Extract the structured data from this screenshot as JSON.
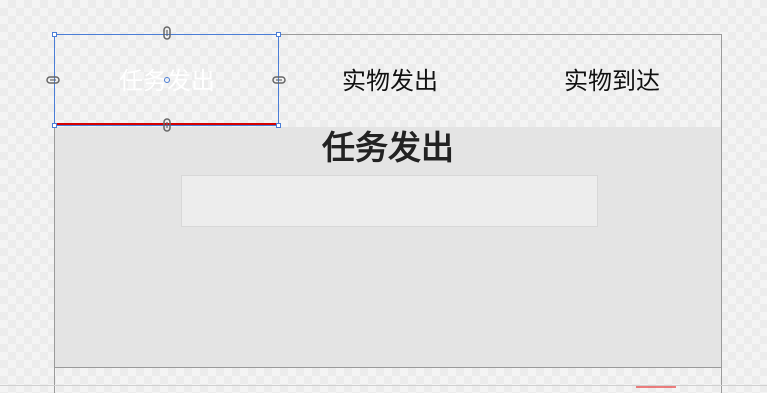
{
  "tabs": [
    {
      "label": "任务发出",
      "active": true
    },
    {
      "label": "实物发出",
      "active": false
    },
    {
      "label": "实物到达",
      "active": false
    }
  ],
  "panel": {
    "title": "任务发出"
  },
  "colors": {
    "active_underline": "#d40000",
    "selection_border": "#4a7dd6",
    "panel_background": "#e4e4e4"
  },
  "icons": {
    "selection_anchors": "paperclip-anchor-icon"
  }
}
